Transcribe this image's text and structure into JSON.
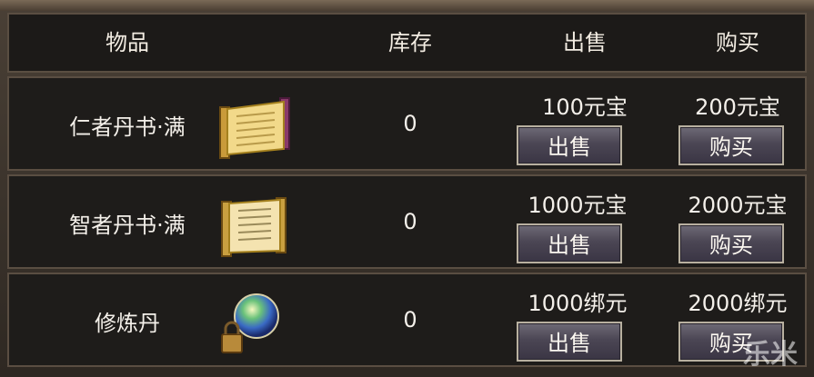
{
  "header": {
    "item": "物品",
    "stock": "库存",
    "sell": "出售",
    "buy": "购买"
  },
  "rows": [
    {
      "name": "仁者丹书·满",
      "icon": "scroll-book-icon",
      "stock": "0",
      "sell_price": "100元宝",
      "buy_price": "200元宝",
      "sell_label": "出售",
      "buy_label": "购买"
    },
    {
      "name": "智者丹书·满",
      "icon": "scroll-book-icon",
      "stock": "0",
      "sell_price": "1000元宝",
      "buy_price": "2000元宝",
      "sell_label": "出售",
      "buy_label": "购买"
    },
    {
      "name": "修炼丹",
      "icon": "pill-orb-icon",
      "stock": "0",
      "sell_price": "1000绑元",
      "buy_price": "2000绑元",
      "sell_label": "出售",
      "buy_label": "购买"
    }
  ],
  "watermark": "乐米",
  "colors": {
    "panel": "#1e1c1a",
    "border": "#5a4e42",
    "text": "#f4f0ea",
    "button": "#4b4654"
  }
}
